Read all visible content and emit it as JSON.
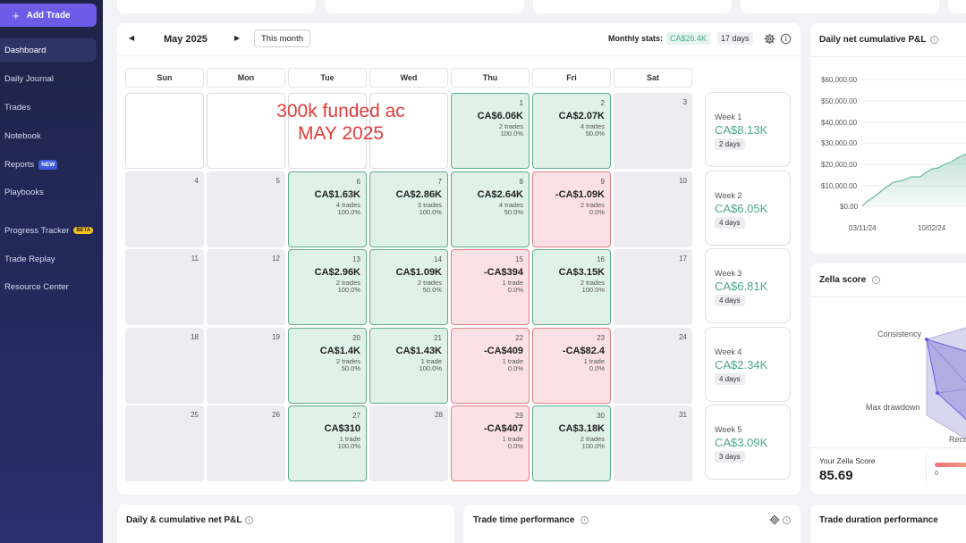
{
  "sidebar": {
    "add_trade_label": "Add Trade",
    "items": [
      {
        "label": "Dashboard"
      },
      {
        "label": "Daily Journal"
      },
      {
        "label": "Trades"
      },
      {
        "label": "Notebook"
      },
      {
        "label": "Reports",
        "badge": "NEW"
      },
      {
        "label": "Playbooks"
      },
      {
        "label": "Progress Tracker",
        "badge": "BETA"
      },
      {
        "label": "Trade Replay"
      },
      {
        "label": "Resource Center"
      }
    ]
  },
  "calendar": {
    "month_label": "May 2025",
    "this_month_label": "This month",
    "stats_label": "Monthly stats:",
    "stats_value": "CA$26.4K",
    "stats_days": "17 days",
    "weekdays": [
      "Sun",
      "Mon",
      "Tue",
      "Wed",
      "Thu",
      "Fri",
      "Sat"
    ],
    "overlay_line1": "300k funded ac",
    "overlay_line2": "MAY 2025",
    "days": [
      {
        "day": "",
        "status": "empty"
      },
      {
        "day": "",
        "status": "empty"
      },
      {
        "day": "",
        "status": "empty"
      },
      {
        "day": "",
        "status": "empty"
      },
      {
        "day": "1",
        "status": "win",
        "pnl": "CA$6.06K",
        "trades": "2 trades",
        "winrate": "100.0%"
      },
      {
        "day": "2",
        "status": "win",
        "pnl": "CA$2.07K",
        "trades": "4 trades",
        "winrate": "50.0%"
      },
      {
        "day": "3",
        "status": "none"
      },
      {
        "day": "4",
        "status": "none"
      },
      {
        "day": "5",
        "status": "none"
      },
      {
        "day": "6",
        "status": "win",
        "pnl": "CA$1.63K",
        "trades": "4 trades",
        "winrate": "100.0%"
      },
      {
        "day": "7",
        "status": "win",
        "pnl": "CA$2.86K",
        "trades": "3 trades",
        "winrate": "100.0%"
      },
      {
        "day": "8",
        "status": "win",
        "pnl": "CA$2.64K",
        "trades": "4 trades",
        "winrate": "50.0%"
      },
      {
        "day": "9",
        "status": "loss",
        "pnl": "-CA$1.09K",
        "trades": "2 trades",
        "winrate": "0.0%"
      },
      {
        "day": "10",
        "status": "none"
      },
      {
        "day": "11",
        "status": "none"
      },
      {
        "day": "12",
        "status": "none"
      },
      {
        "day": "13",
        "status": "win",
        "pnl": "CA$2.96K",
        "trades": "2 trades",
        "winrate": "100.0%"
      },
      {
        "day": "14",
        "status": "win",
        "pnl": "CA$1.09K",
        "trades": "2 trades",
        "winrate": "50.0%"
      },
      {
        "day": "15",
        "status": "loss",
        "pnl": "-CA$394",
        "trades": "1 trade",
        "winrate": "0.0%"
      },
      {
        "day": "16",
        "status": "win",
        "pnl": "CA$3.15K",
        "trades": "2 trades",
        "winrate": "100.0%"
      },
      {
        "day": "17",
        "status": "none"
      },
      {
        "day": "18",
        "status": "none"
      },
      {
        "day": "19",
        "status": "none"
      },
      {
        "day": "20",
        "status": "win",
        "pnl": "CA$1.4K",
        "trades": "2 trades",
        "winrate": "50.0%"
      },
      {
        "day": "21",
        "status": "win",
        "pnl": "CA$1.43K",
        "trades": "1 trade",
        "winrate": "100.0%"
      },
      {
        "day": "22",
        "status": "loss",
        "pnl": "-CA$409",
        "trades": "1 trade",
        "winrate": "0.0%"
      },
      {
        "day": "23",
        "status": "loss",
        "pnl": "-CA$82.4",
        "trades": "1 trade",
        "winrate": "0.0%"
      },
      {
        "day": "24",
        "status": "none"
      },
      {
        "day": "25",
        "status": "none"
      },
      {
        "day": "26",
        "status": "none"
      },
      {
        "day": "27",
        "status": "win",
        "pnl": "CA$310",
        "trades": "1 trade",
        "winrate": "100.0%"
      },
      {
        "day": "28",
        "status": "none"
      },
      {
        "day": "29",
        "status": "loss",
        "pnl": "-CA$407",
        "trades": "1 trade",
        "winrate": "0.0%"
      },
      {
        "day": "30",
        "status": "win",
        "pnl": "CA$3.18K",
        "trades": "2 trades",
        "winrate": "100.0%"
      },
      {
        "day": "31",
        "status": "none"
      }
    ],
    "weeks": [
      {
        "label": "Week 1",
        "value": "CA$8.13K",
        "days": "2 days"
      },
      {
        "label": "Week 2",
        "value": "CA$6.05K",
        "days": "4 days"
      },
      {
        "label": "Week 3",
        "value": "CA$6.81K",
        "days": "4 days"
      },
      {
        "label": "Week 4",
        "value": "CA$2.34K",
        "days": "4 days"
      },
      {
        "label": "Week 5",
        "value": "CA$3.09K",
        "days": "3 days"
      }
    ]
  },
  "cumulative_panel": {
    "title": "Daily net cumulative P&L",
    "y_ticks": [
      "$60,000.00",
      "$50,000.00",
      "$40,000.00",
      "$30,000.00",
      "$20,000.00",
      "$10,000.00",
      "$0.00"
    ],
    "x_ticks": [
      "03/11/24",
      "10/02/24"
    ]
  },
  "zella_panel": {
    "title": "Zella score",
    "axis_labels": [
      "Consistency",
      "Max drawdown",
      "Reco"
    ],
    "score_label": "Your Zella Score",
    "score_value": "85.69",
    "scale_min": "0"
  },
  "bottom_panels": [
    {
      "title": "Daily & cumulative net P&L"
    },
    {
      "title": "Trade time performance"
    },
    {
      "title": "Trade duration performance"
    }
  ],
  "colors": {
    "win_bg": "#dff1e8",
    "loss_bg": "#fbe1e3",
    "accent": "#6c5ce7",
    "positive_text": "#4aa889"
  }
}
